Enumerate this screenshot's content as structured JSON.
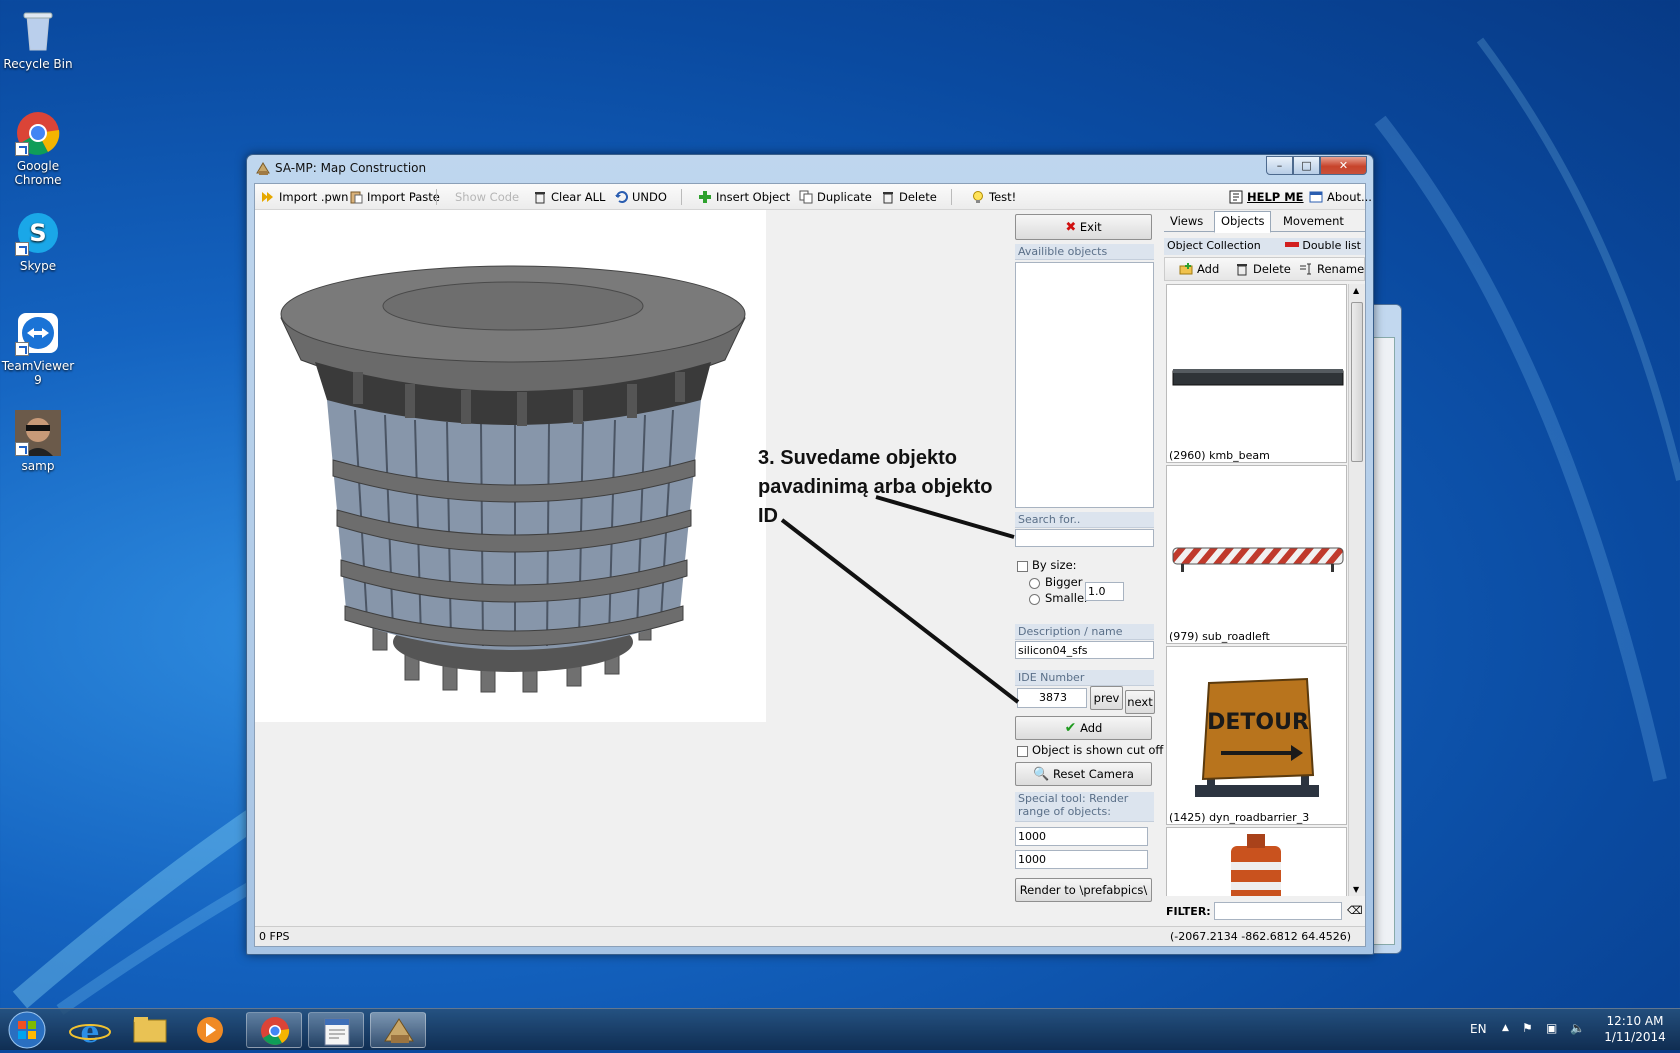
{
  "desktop": {
    "icons": [
      {
        "label": "Recycle Bin"
      },
      {
        "label": "Google Chrome"
      },
      {
        "label": "Skype"
      },
      {
        "label": "TeamViewer 9"
      },
      {
        "label": "samp"
      }
    ]
  },
  "window": {
    "title": "SA-MP: Map Construction",
    "controls": {
      "minimize": "–",
      "maximize": "□",
      "close": "✕"
    }
  },
  "toolbar": {
    "import_pwn": "Import .pwn",
    "import_paste": "Import Paste",
    "show_code": "Show Code",
    "clear_all": "Clear ALL",
    "undo": "UNDO",
    "insert_object": "Insert Object",
    "duplicate": "Duplicate",
    "delete": "Delete",
    "test": "Test!",
    "help_me": "HELP ME",
    "about": "About..."
  },
  "panel": {
    "exit": "Exit",
    "available_objects": "Availible objects",
    "search_label": "Search for..",
    "search_value": "",
    "by_size": "By size:",
    "bigger": "Bigger",
    "smaller": "Smaller",
    "size_value": "1.0",
    "description_label": "Description / name",
    "description_value": "silicon04_sfs",
    "ide_label": "IDE Number",
    "ide_value": "3873",
    "prev": "prev",
    "next": "next",
    "add": "Add",
    "cut_off": "Object is shown cut off?",
    "reset_zoom": "Reset Camera Zoom",
    "special_tool": "Special tool: Render range of objects:",
    "range_from": "1000",
    "range_to": "1000",
    "render": "Render to \\prefabpics\\"
  },
  "right": {
    "tabs": [
      "Views",
      "Objects",
      "Movement"
    ],
    "collection_title": "Object Collection",
    "double_list": "Double list",
    "add": "Add",
    "delete": "Delete",
    "rename": "Rename",
    "objects": [
      {
        "caption": "(2960) kmb_beam"
      },
      {
        "caption": "(979) sub_roadleft"
      },
      {
        "caption": "(1425) dyn_roadbarrier_3",
        "sign_text": "DETOUR"
      },
      {
        "caption": ""
      }
    ],
    "filter_label": "FILTER:",
    "filter_value": ""
  },
  "status": {
    "fps": "0 FPS",
    "coords": "(-2067.2134 -862.6812 64.4526)"
  },
  "annotation": {
    "line1": "3. Suvedame objekto",
    "line2": "pavadinimą arba objekto",
    "line3": "ID"
  },
  "taskbar": {
    "language": "EN",
    "time": "12:10 AM",
    "date": "1/11/2014"
  },
  "colors": {
    "desktop_blue": "#1463c0",
    "close_red": "#c7432b",
    "panel_header": "#dce4ee"
  }
}
